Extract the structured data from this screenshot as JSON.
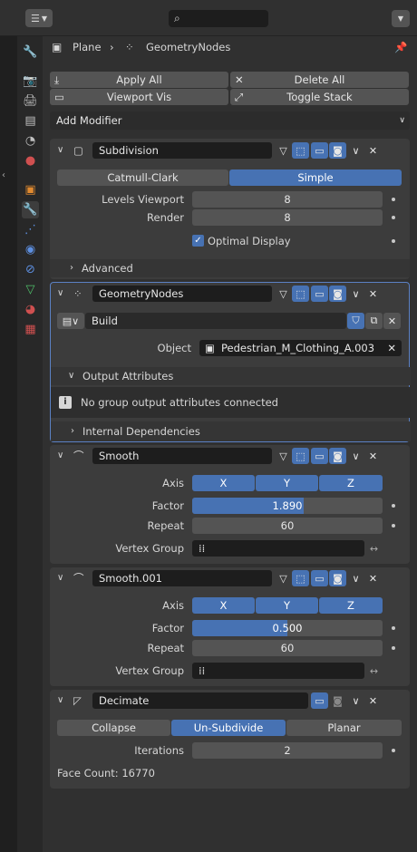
{
  "header": {
    "editor_icon": "properties-editor-icon",
    "search_placeholder": ""
  },
  "breadcrumb": {
    "object": "Plane",
    "modifier": "GeometryNodes"
  },
  "toolbar": {
    "apply_all": "Apply All",
    "delete_all": "Delete All",
    "viewport_vis": "Viewport Vis",
    "toggle_stack": "Toggle Stack"
  },
  "add_modifier": "Add Modifier",
  "subdivision": {
    "name": "Subdivision",
    "mode_a": "Catmull-Clark",
    "mode_b": "Simple",
    "levels_viewport_label": "Levels Viewport",
    "levels_viewport": "8",
    "render_label": "Render",
    "render": "8",
    "optimal_display": "Optimal Display",
    "advanced": "Advanced"
  },
  "geometry_nodes": {
    "name": "GeometryNodes",
    "node_group": "Build",
    "object_label": "Object",
    "object_value": "Pedestrian_M_Clothing_A.003",
    "output_attributes": "Output Attributes",
    "info": "No group output attributes connected",
    "internal_deps": "Internal Dependencies"
  },
  "smooth": {
    "name": "Smooth",
    "axis_label": "Axis",
    "x": "X",
    "y": "Y",
    "z": "Z",
    "factor_label": "Factor",
    "factor": "1.890",
    "factor_fill": 0.585,
    "repeat_label": "Repeat",
    "repeat": "60",
    "vertex_group_label": "Vertex Group"
  },
  "smooth001": {
    "name": "Smooth.001",
    "axis_label": "Axis",
    "x": "X",
    "y": "Y",
    "z": "Z",
    "factor_label": "Factor",
    "factor": "0.500",
    "factor_fill": 0.5,
    "repeat_label": "Repeat",
    "repeat": "60",
    "vertex_group_label": "Vertex Group"
  },
  "decimate": {
    "name": "Decimate",
    "collapse": "Collapse",
    "unsubdivide": "Un-Subdivide",
    "planar": "Planar",
    "iterations_label": "Iterations",
    "iterations": "2",
    "face_count": "Face Count: 16770"
  },
  "colors": {
    "accent": "#4772b3",
    "panel": "#3c3c3c",
    "background": "#303030"
  }
}
